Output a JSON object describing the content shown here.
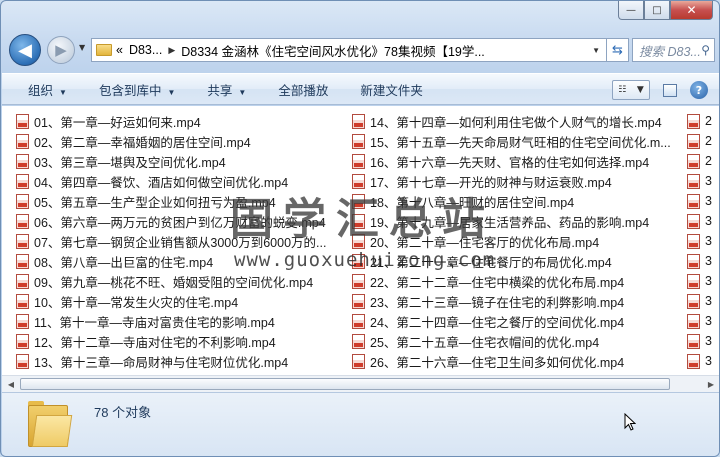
{
  "window": {
    "caption_buttons": {
      "minimize": "—",
      "maximize": "□",
      "close": "✕"
    }
  },
  "nav": {
    "back_icon": "◀",
    "forward_icon": "▶",
    "recent_icon": "▼",
    "address": {
      "overflow": "«",
      "crumb1": "D83...",
      "crumb2": "D8334 金涵林《住宅空间风水优化》78集视频【19学..."
    },
    "refresh_icon": "⇆",
    "search_placeholder": "搜索 D83...",
    "search_icon": "⚲"
  },
  "toolbar": {
    "organize": "组织",
    "include_in_library": "包含到库中",
    "share": "共享",
    "play_all": "全部播放",
    "new_folder": "新建文件夹",
    "help_icon": "?"
  },
  "files": {
    "column1": [
      "01、第一章—好运如何来.mp4",
      "02、第二章—幸福婚姻的居住空间.mp4",
      "03、第三章—堪舆及空间优化.mp4",
      "04、第四章—餐饮、酒店如何做空间优化.mp4",
      "05、第五章—生产型企业如何扭亏为盈.mp4",
      "06、第六章—两万元的贫困户到亿万财富的蜕变.mp4",
      "07、第七章—钢贸企业销售额从3000万到6000万的...",
      "08、第八章—出巨富的住宅.mp4",
      "09、第九章—桃花不旺、婚姻受阻的空间优化.mp4",
      "10、第十章—常发生火灾的住宅.mp4",
      "11、第十一章—寺庙对富贵住宅的影响.mp4",
      "12、第十二章—寺庙对住宅的不利影响.mp4",
      "13、第十三章—命局财神与住宅财位优化.mp4"
    ],
    "column2": [
      "14、第十四章—如何利用住宅做个人财气的增长.mp4",
      "15、第十五章—先天命局财气旺相的住宅空间优化.m...",
      "16、第十六章—先天财、官格的住宅如何选择.mp4",
      "17、第十七章—开光的财神与财运衰败.mp4",
      "18、第十八章—旺财的居住空间.mp4",
      "19、第十九章—居家生活营养品、药品的影响.mp4",
      "20、第二十章—住宅客厅的优化布局.mp4",
      "21、第二十一章—住宅餐厅的布局优化.mp4",
      "22、第二十二章—住宅中横梁的优化布局.mp4",
      "23、第二十三章—镜子在住宅的利弊影响.mp4",
      "24、第二十四章—住宅之餐厅的空间优化.mp4",
      "25、第二十五章—住宅衣帽间的优化.mp4",
      "26、第二十六章—住宅卫生间多如何优化.mp4"
    ],
    "column3": [
      "2",
      "2",
      "2",
      "3",
      "3",
      "3",
      "3",
      "3",
      "3",
      "3",
      "3",
      "3",
      "3"
    ]
  },
  "watermark": {
    "chinese": "国学汇总站",
    "url": "www.guoxuehuizong.com"
  },
  "status": {
    "count": "78 个对象"
  }
}
